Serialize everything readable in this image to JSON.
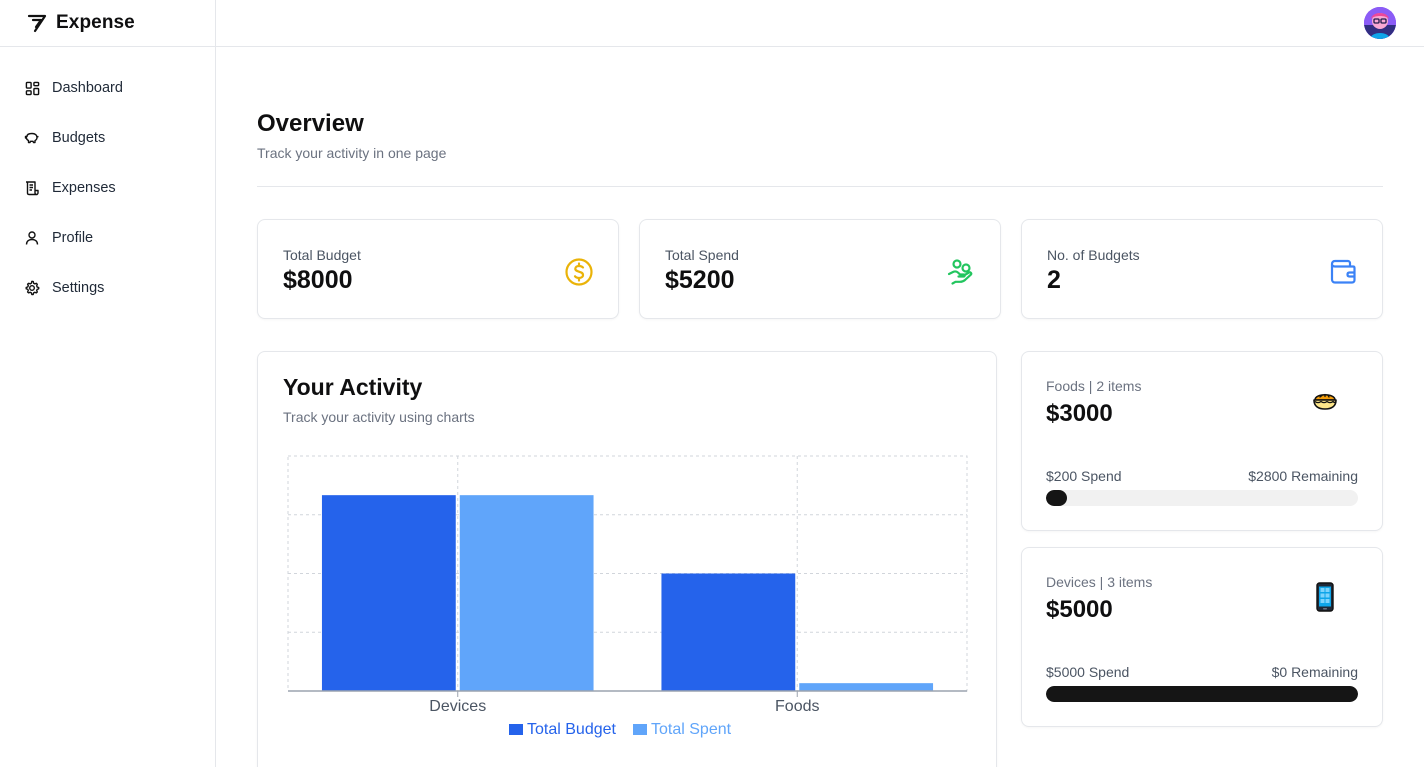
{
  "app": {
    "name": "Expense"
  },
  "sidebar": {
    "items": [
      {
        "label": "Dashboard",
        "icon": "dashboard-icon"
      },
      {
        "label": "Budgets",
        "icon": "piggy-bank-icon"
      },
      {
        "label": "Expenses",
        "icon": "receipt-icon"
      },
      {
        "label": "Profile",
        "icon": "user-icon"
      },
      {
        "label": "Settings",
        "icon": "gear-icon"
      }
    ]
  },
  "header": {
    "avatar": "user-avatar"
  },
  "overview": {
    "title": "Overview",
    "subtitle": "Track your activity in one page"
  },
  "stats": [
    {
      "label": "Total Budget",
      "value": "$8000",
      "icon": "dollar-coin-icon",
      "color": "#eab308"
    },
    {
      "label": "Total Spend",
      "value": "$5200",
      "icon": "hand-coins-icon",
      "color": "#22c55e"
    },
    {
      "label": "No. of Budgets",
      "value": "2",
      "icon": "wallet-icon",
      "color": "#3b82f6"
    }
  ],
  "activity": {
    "title": "Your Activity",
    "subtitle": "Track your activity using charts"
  },
  "chart_data": {
    "type": "bar",
    "categories": [
      "Devices",
      "Foods"
    ],
    "series": [
      {
        "name": "Total Budget",
        "values": [
          5000,
          3000
        ],
        "color": "#2563eb"
      },
      {
        "name": "Total Spent",
        "values": [
          5000,
          200
        ],
        "color": "#60a5fa"
      }
    ],
    "ylim": [
      0,
      6000
    ],
    "grid": true,
    "legend": "bottom-center"
  },
  "budgets": [
    {
      "name": "Foods | 2 items",
      "amount": "$3000",
      "emoji": "pie-emoji",
      "spend": "$200 Spend",
      "remaining": "$2800 Remaining",
      "progress": 0.0667
    },
    {
      "name": "Devices | 3 items",
      "amount": "$5000",
      "emoji": "mobile-phone-emoji",
      "spend": "$5000 Spend",
      "remaining": "$0 Remaining",
      "progress": 1.0
    }
  ]
}
